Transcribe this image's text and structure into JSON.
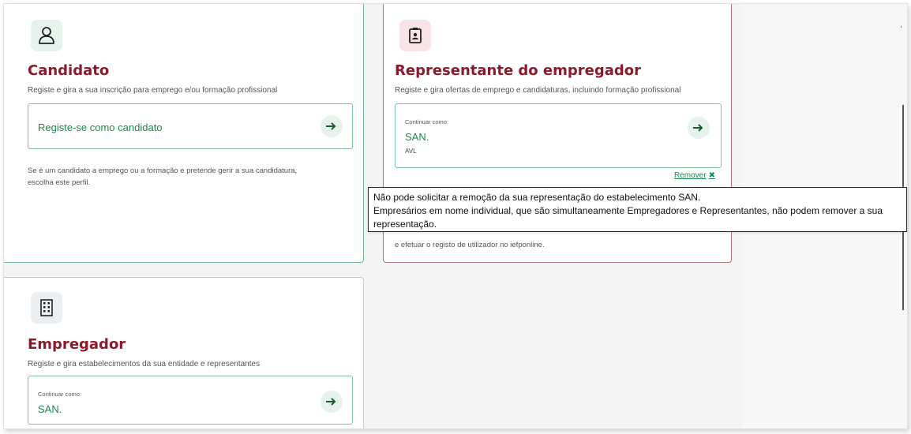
{
  "candidato": {
    "title": "Candidato",
    "subtitle": "Registe e gira a sua inscrição para emprego e/ou formação profissional",
    "action_label": "Registe-se como candidato",
    "description_line1": "Se é um candidato a emprego ou a formação e pretende gerir a sua candidatura,",
    "description_line2": "escolha este perfil.",
    "icon": "user-icon"
  },
  "representante": {
    "title": "Representante do empregador",
    "subtitle": "Registe e gira ofertas de emprego e candidaturas, incluindo formação profissional",
    "continue_label": "Continuar como:",
    "continue_name": "SAN.",
    "continue_sub": "AVL",
    "remove_label": "Remover",
    "remove_x": "✖",
    "description_tail": "e efetuar o registo de utilizador no iefponline.",
    "icon": "badge-icon"
  },
  "empregador": {
    "title": "Empregador",
    "subtitle": "Registe e gira estabelecimentos da sua entidade e representantes",
    "continue_label": "Continuar como:",
    "continue_name": "SAN.",
    "icon": "building-icon"
  },
  "tooltip": {
    "line1": "Não pode solicitar a remoção da sua representação do estabelecimento SAN.",
    "line2": "Empresários em nome individual, que são simultaneamente Empregadores e Representantes, não podem remover a sua",
    "line3": "representação."
  },
  "scroll_top_mark": "‘",
  "colors": {
    "title": "#8b1a2b",
    "accent_green": "#1a8a4d",
    "green_border": "#6fb893",
    "red_border": "#b5707d"
  }
}
